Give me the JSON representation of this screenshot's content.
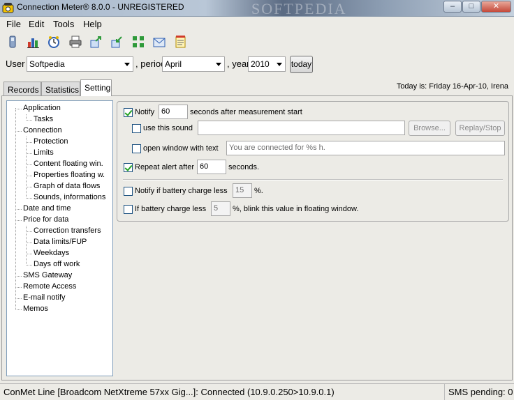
{
  "window": {
    "title": "Connection Meter® 8.0.0 - UNREGISTERED",
    "watermark": "SOFTPEDIA",
    "minimize": "–",
    "maximize": "□",
    "close": "✕"
  },
  "menu": [
    "File",
    "Edit",
    "Tools",
    "Help"
  ],
  "toolbar_icons": [
    "phone-icon",
    "chart-bars-icon",
    "clock-icon",
    "printer-icon",
    "export-icon",
    "import-icon",
    "grid-icon",
    "mail-icon",
    "notes-icon"
  ],
  "userbar": {
    "user_label": "User",
    "user_value": "Softpedia",
    "period_label": ", period",
    "period_value": "April",
    "year_label": ", year",
    "year_value": "2010",
    "today_button": "today"
  },
  "tabs": [
    "Records",
    "Statistics",
    "Setting"
  ],
  "today_text": "Today is: Friday 16-Apr-10, Irena",
  "tree": {
    "items": [
      {
        "label": "Application",
        "level": 0
      },
      {
        "label": "Tasks",
        "level": 1
      },
      {
        "label": "Connection",
        "level": 0
      },
      {
        "label": "Protection",
        "level": 1
      },
      {
        "label": "Limits",
        "level": 1
      },
      {
        "label": "Content floating win.",
        "level": 1
      },
      {
        "label": "Properties floating w.",
        "level": 1
      },
      {
        "label": "Graph of data flows",
        "level": 1
      },
      {
        "label": "Sounds, informations",
        "level": 1
      },
      {
        "label": "Date and time",
        "level": 0
      },
      {
        "label": "Price for data",
        "level": 0
      },
      {
        "label": "Correction transfers",
        "level": 1
      },
      {
        "label": "Data limits/FUP",
        "level": 1
      },
      {
        "label": "Weekdays",
        "level": 1
      },
      {
        "label": "Days off work",
        "level": 1
      },
      {
        "label": "SMS Gateway",
        "level": 0
      },
      {
        "label": "Remote Access",
        "level": 0
      },
      {
        "label": "E-mail notify",
        "level": 0
      },
      {
        "label": "Memos",
        "level": 0
      }
    ]
  },
  "settings": {
    "notify_label": "Notify",
    "notify_value": "60",
    "notify_suffix": "seconds after measurement start",
    "use_sound_label": "use this sound",
    "browse_button": "Browse...",
    "replay_button": "Replay/Stop",
    "open_window_label": "open window with text",
    "open_window_placeholder": "You are connected for %s h.",
    "repeat_label": "Repeat alert after",
    "repeat_value": "60",
    "repeat_suffix": "seconds.",
    "battery_notify_label": "Notify if battery charge less",
    "battery_notify_value": "15",
    "battery_notify_suffix": "%.",
    "battery_blink_label": "If battery charge less",
    "battery_blink_value": "5",
    "battery_blink_suffix": "%, blink this value in floating window."
  },
  "status": {
    "left": "ConMet Line [Broadcom NetXtreme 57xx Gig...]: Connected (10.9.0.250>10.9.0.1)",
    "right": "SMS pending: 0"
  }
}
